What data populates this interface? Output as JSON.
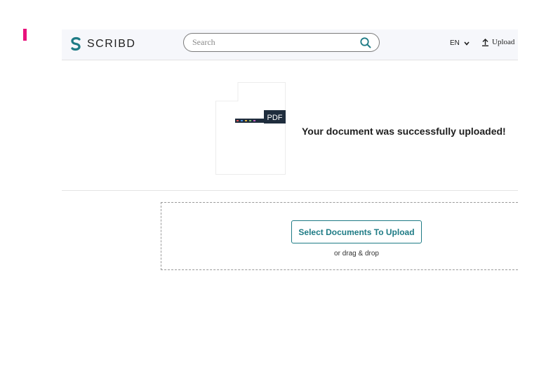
{
  "header": {
    "logo_text": "SCRIBD",
    "search": {
      "placeholder": "Search",
      "value": ""
    },
    "language": "EN",
    "upload_label": "Upload"
  },
  "success": {
    "file_badge": "PDF",
    "message": "Your document was successfully uploaded!"
  },
  "dropzone": {
    "select_button_label": "Select Documents To Upload",
    "drag_text": "or drag & drop"
  },
  "colors": {
    "brand_teal": "#1e7b85",
    "accent_pink": "#e8127c",
    "header_bg": "#f6f7fb",
    "badge_bg": "#1f2d3d"
  },
  "icons": [
    "scribd-logo-icon",
    "search-icon",
    "chevron-down-icon",
    "upload-arrow-icon"
  ]
}
